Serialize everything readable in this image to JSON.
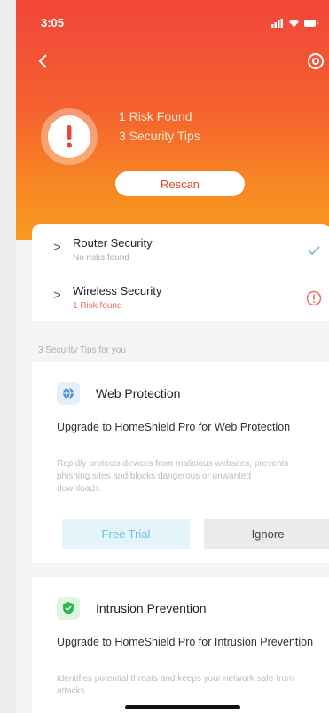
{
  "status_bar": {
    "time": "3:05"
  },
  "hero": {
    "line1": "1 Risk Found",
    "line2": "3 Security Tips",
    "rescan_label": "Rescan"
  },
  "checks": [
    {
      "title": "Router Security",
      "subtitle": "No risks found",
      "state": "ok"
    },
    {
      "title": "Wireless Security",
      "subtitle": "1 Risk found",
      "state": "risk"
    }
  ],
  "tips_label": "3 Security Tips for you",
  "tips": [
    {
      "name": "Web Protection",
      "upgrade_text": "Upgrade to HomeShield Pro for Web Protection",
      "description": "Rapidly protects devices from malicious websites, prevents phishing sites and blocks dangerous or unwanted downloads.",
      "primary_label": "Free Trial",
      "secondary_label": "Ignore",
      "icon_color": "#4a90d9"
    },
    {
      "name": "Intrusion Prevention",
      "upgrade_text": "Upgrade to HomeShield Pro for Intrusion Prevention",
      "description": "Identifies potential threats and keeps your network safe from attacks.",
      "icon_color": "#2eb84b"
    }
  ],
  "colors": {
    "accent": "#f2453a",
    "accent2": "#f99a1d",
    "ok": "#8fb3c8",
    "risk": "#f06a5e"
  }
}
